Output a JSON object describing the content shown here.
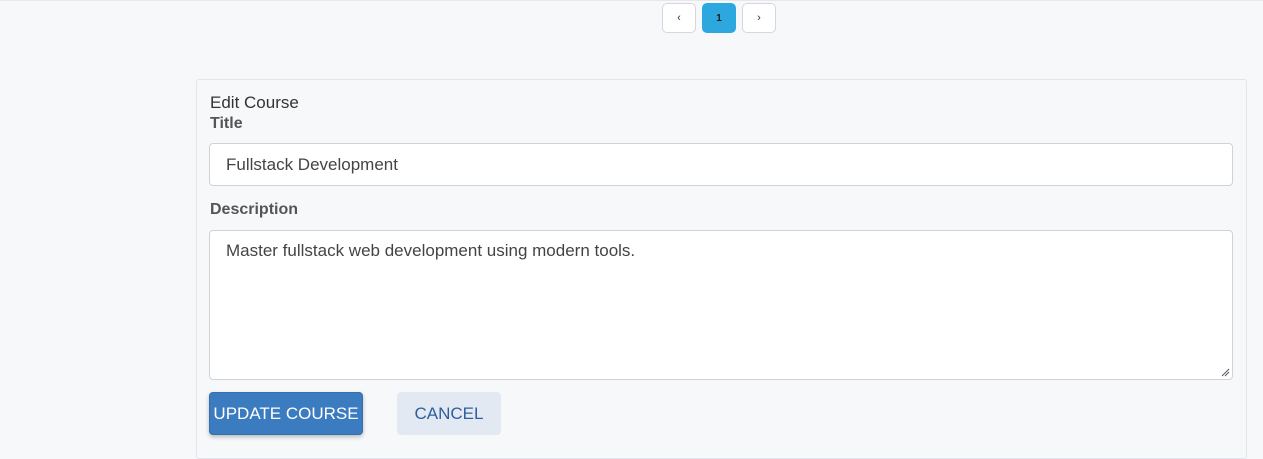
{
  "pagination": {
    "prev_label": "‹",
    "current_page": "1",
    "next_label": "›"
  },
  "form": {
    "heading": "Edit Course",
    "title_label": "Title",
    "title_value": "Fullstack Development",
    "description_label": "Description",
    "description_value": "Master fullstack web development using modern tools.",
    "update_button": "UPDATE COURSE",
    "cancel_button": "CANCEL"
  },
  "colors": {
    "accent": "#2ca8df",
    "primary_button": "#3b7bbf",
    "secondary_button": "#e3e9f3"
  },
  "icons": {
    "resize": "resize-grip-icon"
  }
}
